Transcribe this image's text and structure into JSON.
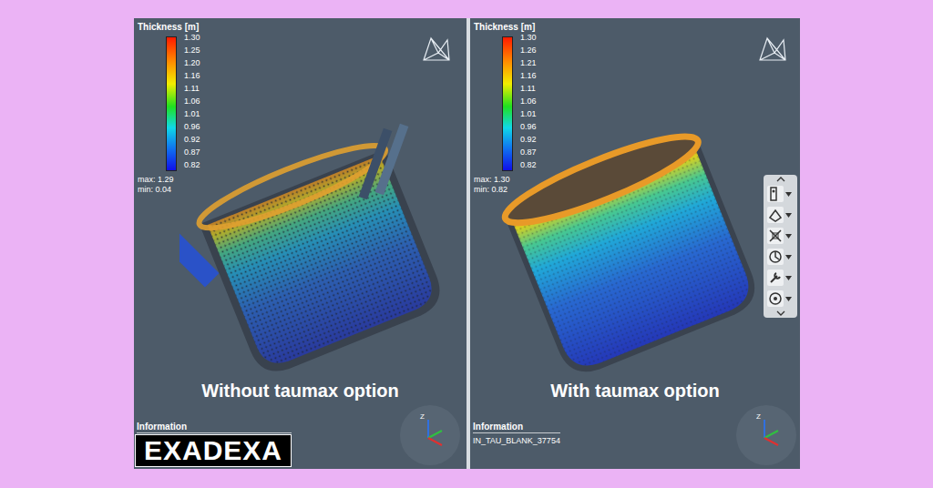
{
  "panels": [
    {
      "kind": "scattered",
      "legend": {
        "title": "Thickness [m]",
        "ticks": [
          "1.30",
          "1.25",
          "1.20",
          "1.16",
          "1.11",
          "1.06",
          "1.01",
          "0.96",
          "0.92",
          "0.87",
          "0.82"
        ],
        "max": "max: 1.29",
        "min": "min: 0.04"
      },
      "caption": "Without taumax option",
      "info_label": "Information",
      "logo": "EXADEXA",
      "axis_label": "Z",
      "toolbar": false
    },
    {
      "kind": "smooth",
      "legend": {
        "title": "Thickness [m]",
        "ticks": [
          "1.30",
          "1.26",
          "1.21",
          "1.16",
          "1.11",
          "1.06",
          "1.01",
          "0.96",
          "0.92",
          "0.87",
          "0.82"
        ],
        "max": "max: 1.30",
        "min": "min: 0.82"
      },
      "caption": "With taumax option",
      "info_label": "Information",
      "info_text": "IN_TAU_BLANK_37754",
      "axis_label": "Z",
      "toolbar": true
    }
  ]
}
